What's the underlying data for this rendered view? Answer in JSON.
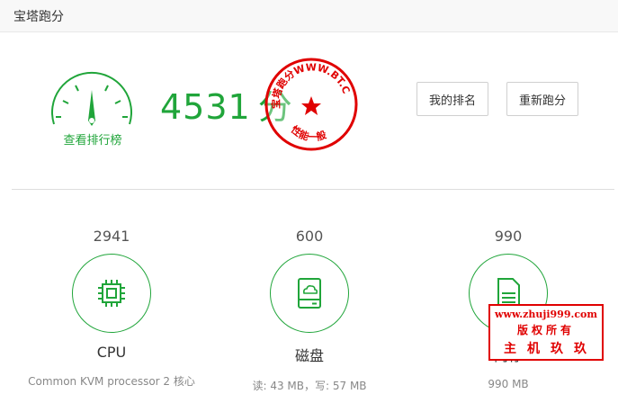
{
  "window": {
    "title": "宝塔跑分"
  },
  "summary": {
    "score": "4531",
    "unit": "分",
    "rank_link": "查看排行榜"
  },
  "buttons": {
    "my_rank": "我的排名",
    "retest": "重新跑分"
  },
  "stats": [
    {
      "value": "2941",
      "label": "CPU",
      "desc": "Common KVM processor 2 核心",
      "icon": "cpu-chip-icon"
    },
    {
      "value": "600",
      "label": "磁盘",
      "desc": "读: 43 MB，写: 57 MB",
      "icon": "disk-drive-icon"
    },
    {
      "value": "990",
      "label": "内存",
      "desc": "990 MB",
      "icon": "memory-card-icon"
    }
  ],
  "seal": {
    "top_text": "宝塔跑分WWW.BT.CN",
    "bottom_text": "性能一般"
  },
  "watermark": {
    "line1": "www.zhuji999.com",
    "line2": "版权所有",
    "line3": "主机玖玖"
  },
  "colors": {
    "accent": "#20a53a",
    "seal_red": "#e00000"
  }
}
